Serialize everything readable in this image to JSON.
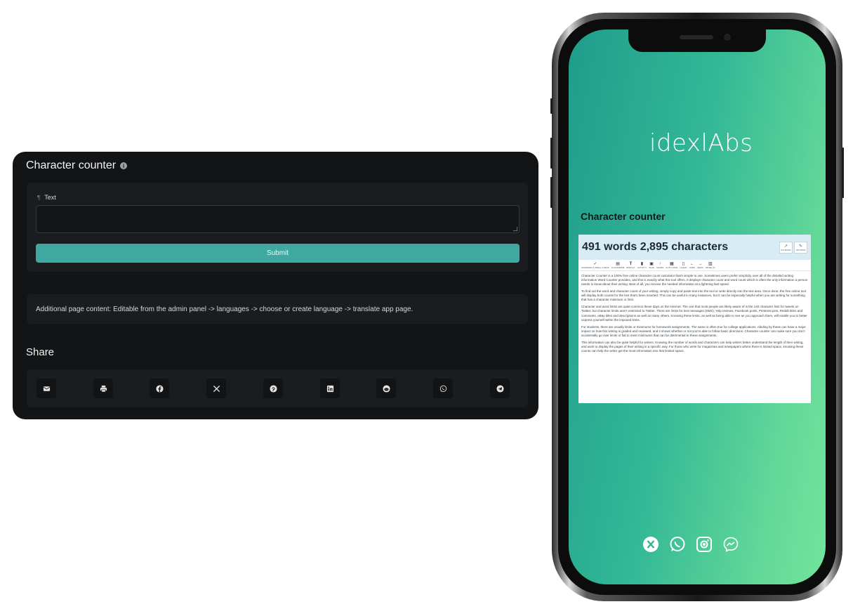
{
  "app": {
    "title": "Character counter",
    "field_label": "Text",
    "text_value": "",
    "submit_label": "Submit",
    "additional_content": "Additional page content: Editable from the admin panel -> languages -> choose or create language -> translate app page.",
    "share_title": "Share",
    "share_buttons": [
      "envelope-icon",
      "print-icon",
      "facebook-icon",
      "x-icon",
      "pinterest-icon",
      "linkedin-icon",
      "reddit-icon",
      "whatsapp-icon",
      "telegram-icon"
    ]
  },
  "phone": {
    "logo": "idexlAbs",
    "heading": "Character counter",
    "embed": {
      "count": "491 words 2,895 characters",
      "head_buttons": [
        "GO BASIC",
        "OPTIONS"
      ],
      "toolbar": [
        "GRAMMAR & SPELL CHECK",
        "PLAGIARISM",
        "DISPLAY",
        "ACTIVITY",
        "SAVE",
        "SHARE",
        "AUTO-SAVE",
        "CLEAR",
        "UNDO",
        "REDO",
        "MORE (3)"
      ],
      "paragraphs": [
        "Character Counter is a 100% free online character count calculator that's simple to use. Sometimes users prefer simplicity over all of the detailed writing information Word Counter provides, and this is exactly what this tool offers. It displays character count and word count which is often the only information a person needs to know about their writing. Best of all, you receive the needed information at a lightning fast speed.",
        "To find out the word and character count of your writing, simply copy and paste text into the tool or write directly into the text area. Once done, the free online tool will display both counts for the text that's been inserted. This can be useful in many instances, but it can be especially helpful when you are writing for something that has a character minimum or limit.",
        "Character and word limits are quite common these days on the Internet. The one that most people are likely aware of is the 140 character limit for tweets on Twitter, but character limits aren't restricted to Twitter. There are limits for text messages (SMS), Yelp reviews, Facebook posts, Pinterest pins, Reddit titles and comments, eBay titles and descriptions as well as many others. Knowing these limits, as well as being able to see as you approach them, will enable you to better express yourself within the imposed limits.",
        "For students, there are usually limits or minimums for homework assignments. The same is often true for college applications. Abiding by these can have a major impact on how this writing is graded and reviewed, and it shows whether or not you're able to follow basic directions. Character counter can make sure you don't accidentally go over limits or fail to meet minimums that can be detrimental to these assignments.",
        "This information can also be quite helpful for writers. Knowing the number of words and characters can help writers better understand the length of their writing, and work to display the pages of their writing in a specific way. For those who write for magazines and newspapers where there is limited space, knowing these counts can help the writer get the most information into that limited space."
      ]
    },
    "social": [
      "x-icon",
      "whatsapp-icon",
      "instagram-icon",
      "messenger-icon"
    ]
  }
}
